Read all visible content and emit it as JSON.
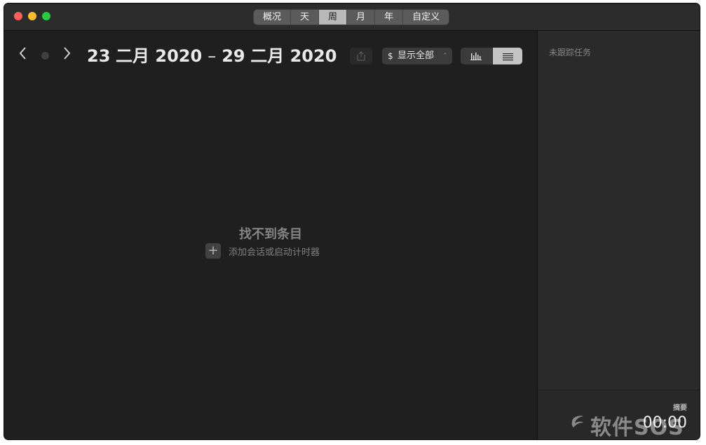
{
  "titlebar": {
    "tabs": [
      {
        "label": "概况",
        "active": false
      },
      {
        "label": "天",
        "active": false
      },
      {
        "label": "周",
        "active": true
      },
      {
        "label": "月",
        "active": false
      },
      {
        "label": "年",
        "active": false
      },
      {
        "label": "自定义",
        "active": false
      }
    ]
  },
  "toolbar": {
    "range_start_day": "23",
    "range_start_rest": "二月 2020",
    "range_sep": "–",
    "range_end_day": "29",
    "range_end_rest": "二月 2020",
    "filter_currency": "$",
    "filter_label": "显示全部"
  },
  "empty_state": {
    "title": "找不到条目",
    "action": "添加会话或启动计时器",
    "add_symbol": "+"
  },
  "sidebar": {
    "title": "未跟踪任务",
    "summary_label": "摘要",
    "summary_time": "00:00"
  },
  "watermark": {
    "text": "软件SOS"
  },
  "colors": {
    "accent_active_tab": "#b9b9b9",
    "window_bg": "#1f1f1f",
    "sidebar_bg": "#2a2a2a"
  }
}
